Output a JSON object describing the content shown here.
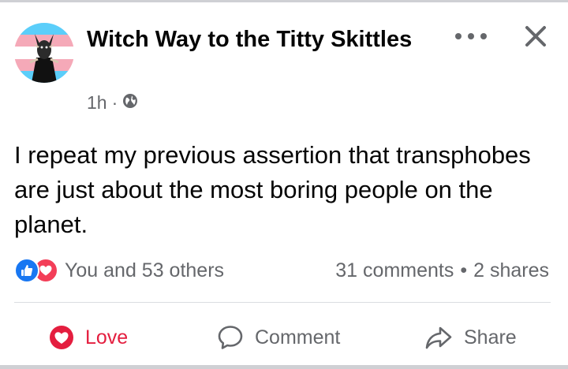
{
  "post": {
    "author": "Witch Way to the Titty Skittles",
    "time": "1h",
    "meta_separator": "·",
    "privacy_icon": "globe-icon",
    "text": "I repeat my previous assertion that transphobes are just about the most boring people on the planet.",
    "reactions_text": "You and 53 others",
    "reaction_icons": [
      "like-icon",
      "love-icon"
    ],
    "comments": "31 comments",
    "shares": "2 shares",
    "stats_separator": "•"
  },
  "actions": {
    "love_label": "Love",
    "comment_label": "Comment",
    "share_label": "Share"
  },
  "colors": {
    "love": "#e41e3f",
    "like": "#1877f2",
    "text_secondary": "#65676b",
    "text_primary": "#050505"
  }
}
